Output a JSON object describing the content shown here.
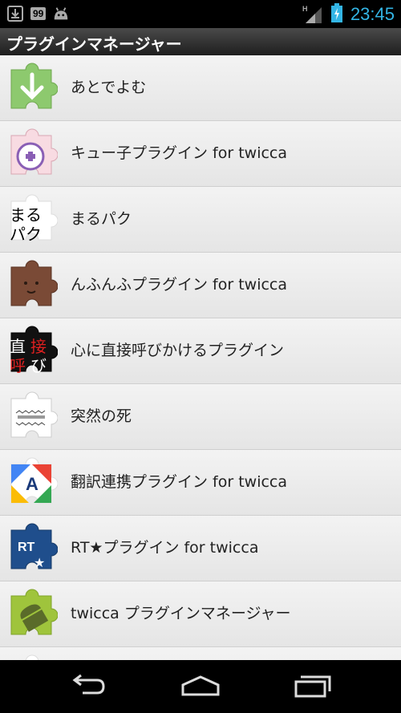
{
  "status_bar": {
    "badge": "99",
    "network": "H",
    "time": "23:45",
    "icons": [
      "download-icon",
      "badge-icon",
      "android-icon",
      "signal-icon",
      "battery-icon"
    ]
  },
  "app": {
    "title": "プラグインマネージャー"
  },
  "plugins": [
    {
      "label": "あとでよむ",
      "icon": "puzzle-green-down-arrow-icon",
      "icon_color": "#8dc96e"
    },
    {
      "label": "キュー子プラグイン for twicca",
      "icon": "puzzle-pink-purple-icon",
      "icon_color": "#f3c6cf"
    },
    {
      "label": "まるパク",
      "icon": "puzzle-text-marupaku-icon",
      "icon_color": "#ffffff",
      "icon_text": [
        "まる",
        "パク"
      ]
    },
    {
      "label": "んふんふプラグイン for twicca",
      "icon": "puzzle-brown-face-icon",
      "icon_color": "#7a4a36"
    },
    {
      "label": "心に直接呼びかけるプラグイン",
      "icon": "puzzle-black-kanji-icon",
      "icon_color": "#111111",
      "icon_text": [
        "直",
        "接",
        "呼",
        "び"
      ]
    },
    {
      "label": "突然の死",
      "icon": "puzzle-white-sudden-death-icon",
      "icon_color": "#ffffff"
    },
    {
      "label": "翻訳連携プラグイン for twicca",
      "icon": "puzzle-translate-icon",
      "icon_color": "#4285f4"
    },
    {
      "label": "RT★プラグイン for twicca",
      "icon": "puzzle-blue-rt-icon",
      "icon_color": "#1f4e8c",
      "icon_text": [
        "RT",
        "★"
      ]
    },
    {
      "label": "twicca プラグインマネージャー",
      "icon": "puzzle-green-android-icon",
      "icon_color": "#9fc43c"
    }
  ],
  "nav": {
    "back": "back-icon",
    "home": "home-icon",
    "recents": "recents-icon"
  }
}
